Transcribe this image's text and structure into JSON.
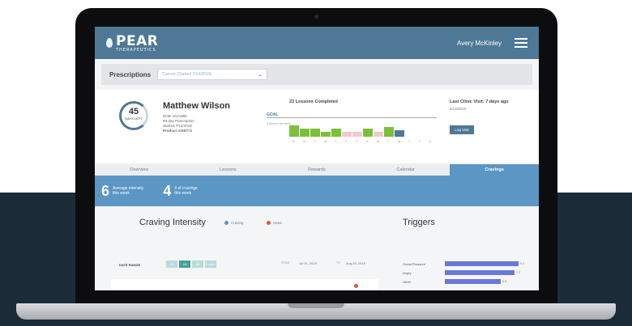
{
  "app": {
    "brand": "PEAR",
    "brand_sub": "THERAPEUTICS",
    "user_name": "Avery McKinley"
  },
  "prescriptions": {
    "label": "Prescriptions",
    "selected": "Current (Started 7/14/2019)"
  },
  "patient": {
    "days_left": "45",
    "days_left_label": "DAYS LEFT",
    "name": "Matthew Wilson",
    "dob": "DOB: 5/1/1986",
    "rx_length": "90-day Prescription",
    "started": "Started 7/14/2019",
    "product": "Product reSET-O"
  },
  "lessons": {
    "title": "23 Lessons Completed",
    "goal_label": "GOAL",
    "goal_sub": "3 lessons per week",
    "completed_pattern": [
      "green",
      "green",
      "green",
      "green",
      "green",
      "pink",
      "pink",
      "green",
      "pink",
      "green",
      "blue"
    ],
    "day_ticks": [
      "S",
      "M",
      "T",
      "W",
      "T",
      "F",
      "S",
      "S",
      "M",
      "T",
      "W",
      "T",
      "F",
      "S"
    ]
  },
  "clinic": {
    "title": "Last Clinic Visit: 7 days ago",
    "date": "8/14/2019",
    "log_visit": "Log Visit"
  },
  "tabs": [
    {
      "label": "Overview",
      "active": false
    },
    {
      "label": "Lessons",
      "active": false
    },
    {
      "label": "Rewards",
      "active": false
    },
    {
      "label": "Calendar",
      "active": false
    },
    {
      "label": "Cravings",
      "active": true
    }
  ],
  "stats": [
    {
      "value": "6",
      "label_1": "Average intensity",
      "label_2": "this week"
    },
    {
      "value": "4",
      "label_1": "# of cravings",
      "label_2": "this week"
    }
  ],
  "craving": {
    "title": "Craving Intensity",
    "legend": [
      {
        "name": "Craving",
        "color": "#5b96c4"
      },
      {
        "name": "Used",
        "color": "#e05a2b"
      }
    ],
    "date_range_label": "DATE RANGE",
    "range_buttons": [
      {
        "label": "1W",
        "on": false
      },
      {
        "label": "1M",
        "on": true
      },
      {
        "label": "3M",
        "on": false
      },
      {
        "label": "Custom",
        "on": false
      }
    ],
    "from_label": "FROM",
    "from_value": "Jul 01, 2019",
    "to_label": "TO",
    "to_value": "Aug 29, 2019"
  },
  "triggers": {
    "title": "Triggers",
    "items": [
      {
        "label": "Social Pressure",
        "value": "9.3",
        "fraction": 0.93
      },
      {
        "label": "Angry",
        "value": "7.2",
        "fraction": 0.88
      },
      {
        "label": "Other",
        "value": "5.8",
        "fraction": 0.7
      }
    ],
    "bar_color": "#6a78d6"
  }
}
